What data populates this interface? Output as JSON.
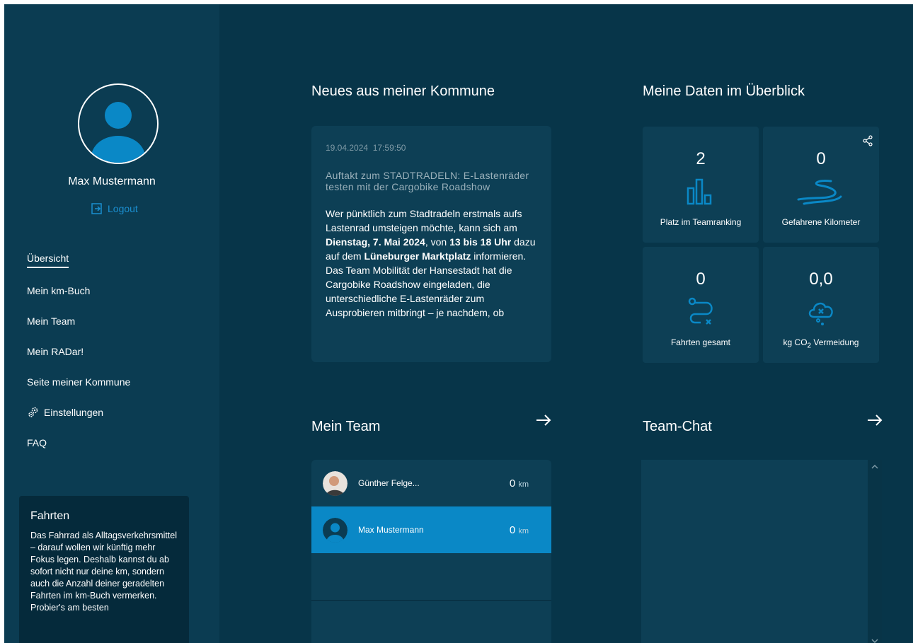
{
  "user": {
    "name": "Max Mustermann",
    "logout_label": "Logout"
  },
  "nav": {
    "items": [
      {
        "label": "Übersicht",
        "active": true
      },
      {
        "label": "Mein km-Buch"
      },
      {
        "label": "Mein Team"
      },
      {
        "label": "Mein RADar!"
      },
      {
        "label": "Seite meiner Kommune"
      },
      {
        "label": "Einstellungen",
        "icon": "gear-icon"
      },
      {
        "label": "FAQ"
      }
    ]
  },
  "info_box": {
    "title": "Fahrten",
    "text": "Das Fahrrad als Alltagsverkehrsmittel – darauf wollen wir künftig mehr Fokus legen. Deshalb kannst du ab sofort nicht nur deine km, sondern auch die Anzahl deiner geradelten Fahrten im km-Buch vermerken. Probier's am besten"
  },
  "news": {
    "section_title": "Neues aus meiner Kommune",
    "date": "19.04.2024",
    "time": "17:59:50",
    "headline": "Auftakt zum STADTRADELN: E-Lastenräder testen mit der Cargobike Roadshow",
    "body_1": "Wer pünktlich zum Stadtradeln erstmals aufs Lastenrad umsteigen möchte, kann sich am ",
    "body_bold_1": "Dienstag, 7. Mai 2024",
    "body_2": ", von ",
    "body_bold_2": "13 bis 18 Uhr",
    "body_3": " dazu auf dem ",
    "body_bold_3": "Lüneburger Marktplatz",
    "body_4": " informieren. Das Team Mobilität der Hansestadt hat die Cargobike Roadshow eingeladen, die unterschiedliche E-Lastenräder zum Ausprobieren mitbringt – je nachdem, ob"
  },
  "stats": {
    "section_title": "Meine Daten im Überblick",
    "tiles": [
      {
        "value": "2",
        "label": "Platz im Teamranking",
        "icon": "bar-chart-icon"
      },
      {
        "value": "0",
        "label": "Gefahrene Kilometer",
        "icon": "route-curve-icon"
      },
      {
        "value": "0",
        "label": "Fahrten gesamt",
        "icon": "route-path-icon"
      },
      {
        "value": "0,0",
        "label_prefix": "kg CO",
        "label_sub": "2",
        "label_suffix": " Vermeidung",
        "icon": "co2-cloud-icon"
      }
    ]
  },
  "team": {
    "section_title": "Mein Team",
    "members": [
      {
        "name": "Günther Felge...",
        "km_value": "0",
        "km_unit": "km",
        "selected": false
      },
      {
        "name": "Max Mustermann",
        "km_value": "0",
        "km_unit": "km",
        "selected": true
      }
    ]
  },
  "chat": {
    "section_title": "Team-Chat"
  },
  "colors": {
    "background": "#073549",
    "sidebar": "#0b3c52",
    "card": "#0d3f55",
    "accent": "#0a88c6",
    "link": "#1b8ecf"
  }
}
